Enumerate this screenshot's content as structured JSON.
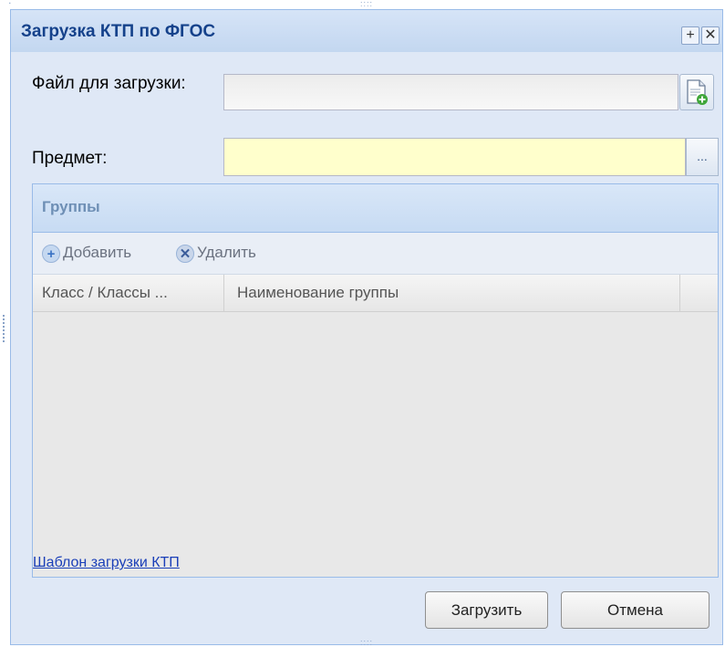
{
  "window": {
    "title": "Загрузка КТП по ФГОС",
    "tools": {
      "maximize": "+",
      "close": "✕"
    }
  },
  "form": {
    "file_label": "Файл для загрузки:",
    "file_value": "",
    "subject_label": "Предмет:",
    "subject_value": "",
    "subject_trigger": "..."
  },
  "groups": {
    "title": "Группы",
    "add_label": "Добавить",
    "delete_label": "Удалить",
    "columns": [
      "Класс / Классы ...",
      "Наименование группы"
    ]
  },
  "template_link": "Шаблон загрузки КТП",
  "buttons": {
    "upload": "Загрузить",
    "cancel": "Отмена"
  },
  "colors": {
    "subject_field": "#ffffcc",
    "panel_bg": "#dfe8f6",
    "title_text": "#15428b",
    "link": "#1a3fb8"
  }
}
